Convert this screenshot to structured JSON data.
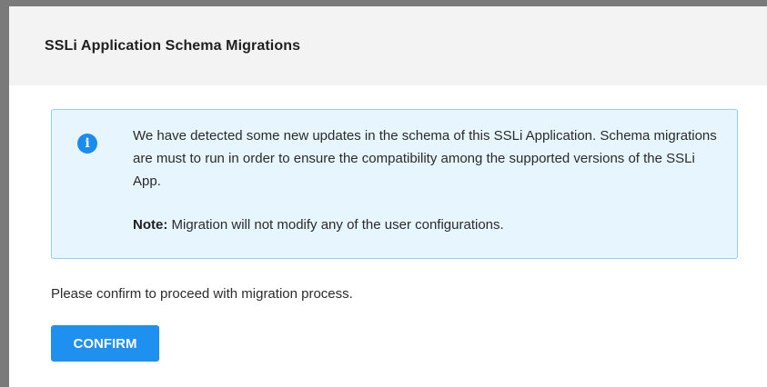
{
  "dialog": {
    "title": "SSLi Application Schema Migrations"
  },
  "info": {
    "icon": "info-icon",
    "message": "We have detected some new updates in the schema of this SSLi Application. Schema migrations are must to run in order to ensure the compatibility among the supported versions of the SSLi App.",
    "note_label": "Note:",
    "note_text": " Migration will not modify any of the user configurations."
  },
  "confirm": {
    "prompt": "Please confirm to proceed with migration process.",
    "button_label": "CONFIRM"
  },
  "colors": {
    "accent": "#1e90f0",
    "info_background": "#e6f5fe",
    "info_border": "#8fd0f5"
  }
}
